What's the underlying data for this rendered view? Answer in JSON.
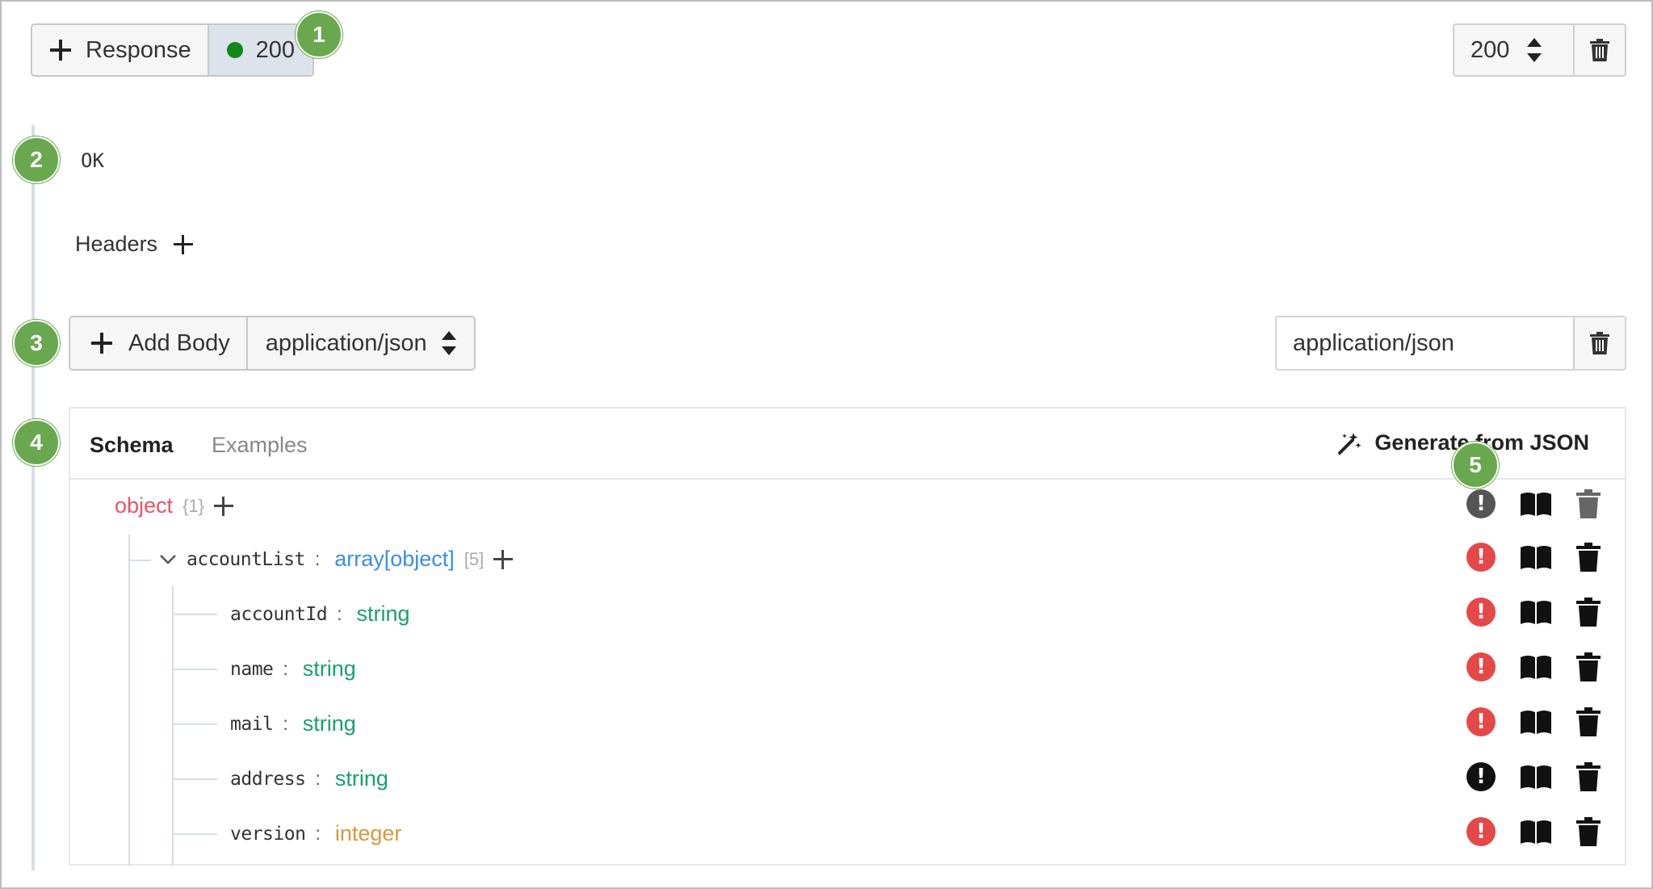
{
  "response": {
    "add_label": "Response",
    "active_code": "200",
    "code_select_value": "200",
    "description": "OK"
  },
  "headers": {
    "label": "Headers"
  },
  "body": {
    "add_label": "Add Body",
    "type_select_value": "application/json",
    "media_type_value": "application/json"
  },
  "tabs": {
    "schema": "Schema",
    "examples": "Examples"
  },
  "generate": {
    "label": "Generate from JSON"
  },
  "badges": [
    "1",
    "2",
    "3",
    "4",
    "5"
  ],
  "schema": {
    "root": {
      "type": "object",
      "count": "{1}"
    },
    "array": {
      "name": "accountList",
      "type": "array[object]",
      "count": "[5]"
    },
    "fields": [
      {
        "name": "accountId",
        "type": "string",
        "required_color": "red"
      },
      {
        "name": "name",
        "type": "string",
        "required_color": "red"
      },
      {
        "name": "mail",
        "type": "string",
        "required_color": "red"
      },
      {
        "name": "address",
        "type": "string",
        "required_color": "black"
      },
      {
        "name": "version",
        "type": "integer",
        "required_color": "red"
      }
    ]
  },
  "colors": {
    "status_dot": "#11881a",
    "badge": "#6aa84f",
    "object": "#e9536b",
    "array": "#3a8ee6",
    "string": "#1aa06d",
    "integer": "#d49a3c",
    "required": "#e44848"
  },
  "colon": ":"
}
